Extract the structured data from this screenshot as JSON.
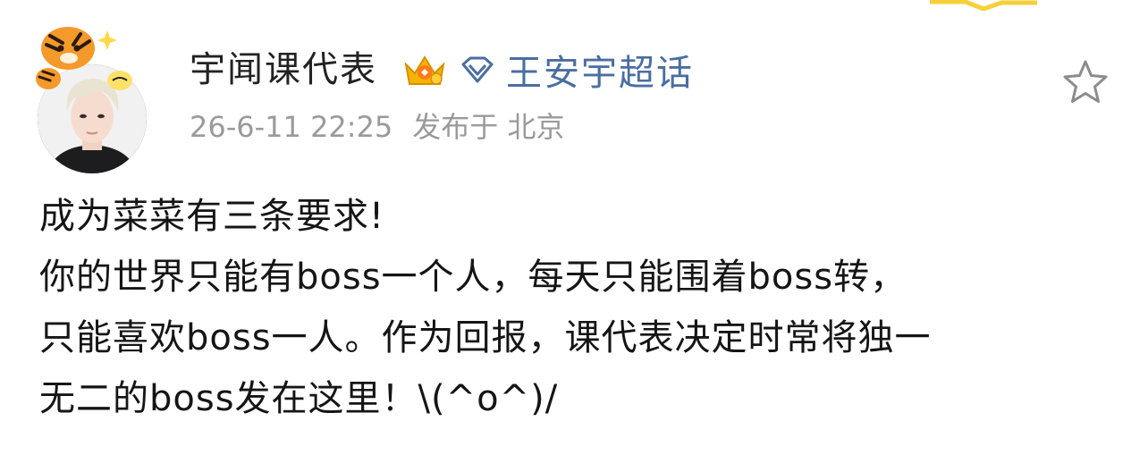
{
  "post": {
    "author": {
      "name": "宇闻课代表",
      "avatar_icon": "person-photo-avatar-icon",
      "pendant_icon": "tiger-pendant-icon",
      "badge_icon": "gold-crown-badge-icon"
    },
    "topic": {
      "icon": "diamond-icon",
      "label": "王安宇超话",
      "color": "#4a6ea0"
    },
    "meta": {
      "timestamp": "26-6-11 22:25",
      "location": "发布于 北京"
    },
    "actions": {
      "favorite_icon": "star-outline-icon"
    },
    "content": {
      "lines": [
        "成为菜菜有三条要求!",
        "你的世界只能有boss一个人，每天只能围着boss转，",
        "只能喜欢boss一人。作为回报，课代表决定时常将独一",
        "无二的boss发在这里！\\(^o^)/"
      ]
    }
  },
  "colors": {
    "text_primary": "#222222",
    "text_secondary": "#9a9a9a",
    "link": "#4a6ea0",
    "badge_gold": "#f5b400"
  }
}
